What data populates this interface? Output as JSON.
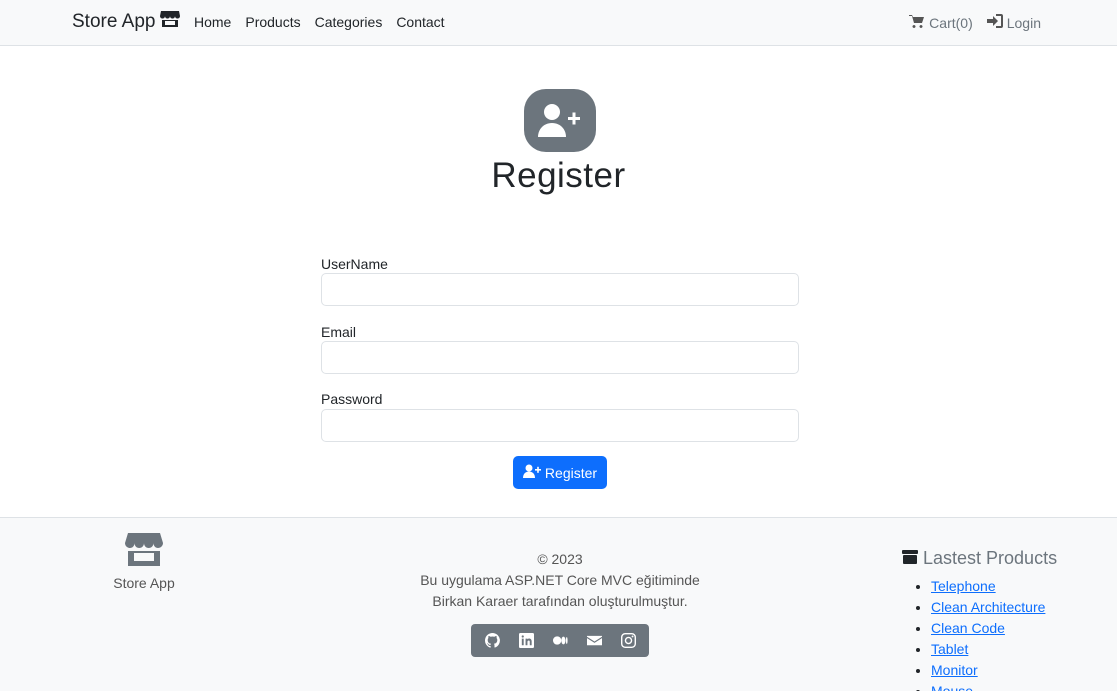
{
  "navbar": {
    "brand": "Store App",
    "links": [
      "Home",
      "Products",
      "Categories",
      "Contact"
    ],
    "cart": "Cart(0)",
    "login": "Login"
  },
  "page": {
    "title": "Register"
  },
  "form": {
    "username_label": "UserName",
    "email_label": "Email",
    "password_label": "Password",
    "username_value": "",
    "email_value": "",
    "password_value": "",
    "submit_label": "Register"
  },
  "footer": {
    "brand": "Store App",
    "copyright": "© 2023",
    "line1": "Bu uygulama ASP.NET Core MVC eğitiminde",
    "line2": "Birkan Karaer tarafından oluşturulmuştur.",
    "social_icons": [
      "github-icon",
      "linkedin-icon",
      "medium-icon",
      "email-icon",
      "instagram-icon"
    ],
    "latest_title": "Lastest Products",
    "latest_products": [
      "Telephone",
      "Clean Architecture",
      "Clean Code",
      "Tablet",
      "Monitor",
      "Mouse"
    ]
  },
  "colors": {
    "primary": "#0d6efd",
    "secondary": "#6c757d",
    "navbar_bg": "#f8f9fa"
  }
}
